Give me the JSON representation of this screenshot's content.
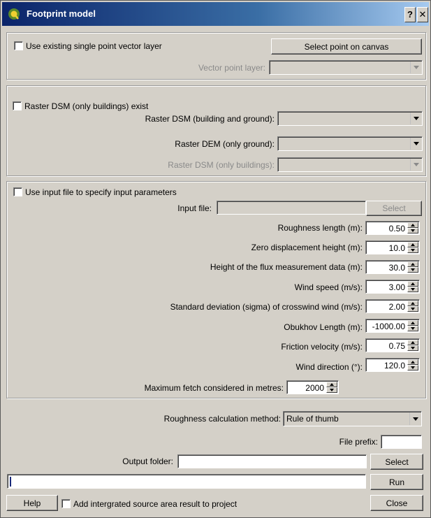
{
  "window": {
    "title": "Footprint model",
    "help_label": "?",
    "close_label": "✕"
  },
  "point": {
    "use_existing_label": "Use existing single point vector layer",
    "select_point_label": "Select point on canvas",
    "vector_layer_label": "Vector point layer:",
    "vector_layer_value": ""
  },
  "raster": {
    "dsm_exist_label": "Raster DSM (only buildings) exist",
    "dsm_building_ground_label": "Raster DSM (building and ground):",
    "dsm_building_ground_value": "",
    "dem_label": "Raster DEM (only ground):",
    "dem_value": "",
    "dsm_buildings_label": "Raster DSM (only buildings):",
    "dsm_buildings_value": ""
  },
  "params": {
    "use_input_file_label": "Use input file to specify input parameters",
    "input_file_label": "Input file:",
    "input_file_value": "",
    "select_label": "Select",
    "fields": [
      {
        "label": "Roughness length (m):",
        "value": "0.50"
      },
      {
        "label": "Zero displacement height (m):",
        "value": "10.0"
      },
      {
        "label": "Height of the flux measurement data (m):",
        "value": "30.0"
      },
      {
        "label": "Wind speed (m/s):",
        "value": "3.00"
      },
      {
        "label": "Standard deviation (sigma) of crosswind wind (m/s):",
        "value": "2.00"
      },
      {
        "label": "Obukhov Length (m):",
        "value": "-1000.00"
      },
      {
        "label": "Friction velocity (m/s):",
        "value": "0.75"
      },
      {
        "label": "Wind direction (°):",
        "value": "120.0"
      }
    ],
    "max_fetch_label": "Maximum fetch considered in metres:",
    "max_fetch_value": "2000"
  },
  "output": {
    "method_label": "Roughness calculation method:",
    "method_value": "Rule of thumb",
    "file_prefix_label": "File prefix:",
    "file_prefix_value": "",
    "output_folder_label": "Output folder:",
    "output_folder_value": "",
    "select_label": "Select",
    "run_label": "Run",
    "progress": 0
  },
  "footer": {
    "help_label": "Help",
    "add_result_label": "Add intergrated source area result to project",
    "close_label": "Close"
  }
}
